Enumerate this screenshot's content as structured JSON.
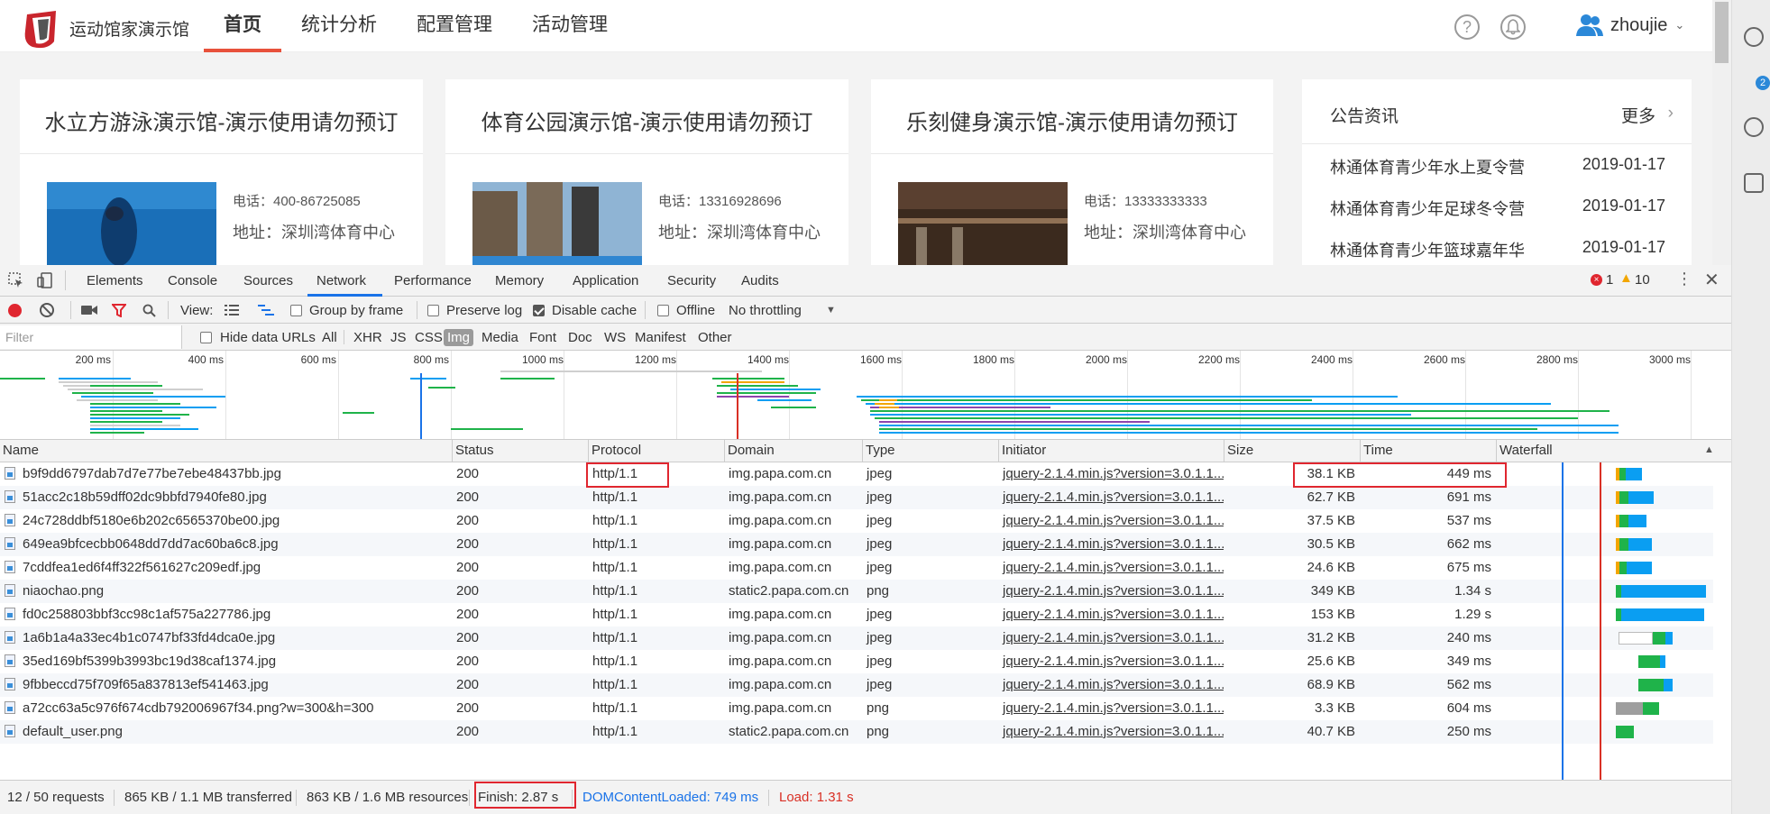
{
  "site": {
    "brand": "运动馆家演示馆",
    "nav": [
      "首页",
      "统计分析",
      "配置管理",
      "活动管理"
    ],
    "user": "zhoujie",
    "cards": [
      {
        "title": "水立方游泳演示馆-演示使用请勿预订",
        "phone": "电话：400-86725085",
        "address": "地址：深圳湾体育中心"
      },
      {
        "title": "体育公园演示馆-演示使用请勿预订",
        "phone": "电话：13316928696",
        "address": "地址：深圳湾体育中心"
      },
      {
        "title": "乐刻健身演示馆-演示使用请勿预订",
        "phone": "电话：13333333333",
        "address": "地址：深圳湾体育中心"
      }
    ],
    "notice": {
      "title": "公告资讯",
      "more": "更多",
      "items": [
        {
          "text": "林通体育青少年水上夏令营",
          "date": "2019-01-17"
        },
        {
          "text": "林通体育青少年足球冬令营",
          "date": "2019-01-17"
        },
        {
          "text": "林通体育青少年篮球嘉年华",
          "date": "2019-01-17"
        }
      ]
    },
    "side_badge": "2"
  },
  "devtools": {
    "tabs": [
      "Elements",
      "Console",
      "Sources",
      "Network",
      "Performance",
      "Memory",
      "Application",
      "Security",
      "Audits"
    ],
    "active_tab": "Network",
    "errors": "1",
    "warnings": "10",
    "toolbar": {
      "view_label": "View:",
      "group_by_frame": "Group by frame",
      "preserve_log": "Preserve log",
      "disable_cache": "Disable cache",
      "offline": "Offline",
      "throttling": "No throttling"
    },
    "filter": {
      "placeholder": "Filter",
      "hide_data_urls": "Hide data URLs",
      "types": [
        "All",
        "XHR",
        "JS",
        "CSS",
        "Img",
        "Media",
        "Font",
        "Doc",
        "WS",
        "Manifest",
        "Other"
      ],
      "active_type": "Img"
    },
    "overview_ticks": [
      "200 ms",
      "400 ms",
      "600 ms",
      "800 ms",
      "1000 ms",
      "1200 ms",
      "1400 ms",
      "1600 ms",
      "1800 ms",
      "2000 ms",
      "2200 ms",
      "2400 ms",
      "2600 ms",
      "2800 ms",
      "3000 ms"
    ],
    "columns": [
      "Name",
      "Status",
      "Protocol",
      "Domain",
      "Type",
      "Initiator",
      "Size",
      "Time",
      "Waterfall"
    ],
    "rows": [
      {
        "name": "b9f9dd6797dab7d7e77be7ebe48437bb.jpg",
        "status": "200",
        "protocol": "http/1.1",
        "domain": "img.papa.com.cn",
        "type": "jpeg",
        "initiator": "jquery-2.1.4.min.js?version=3.0.1.1...",
        "size": "38.1 KB",
        "time": "449 ms"
      },
      {
        "name": "51acc2c18b59dff02dc9bbfd7940fe80.jpg",
        "status": "200",
        "protocol": "http/1.1",
        "domain": "img.papa.com.cn",
        "type": "jpeg",
        "initiator": "jquery-2.1.4.min.js?version=3.0.1.1...",
        "size": "62.7 KB",
        "time": "691 ms"
      },
      {
        "name": "24c728ddbf5180e6b202c6565370be00.jpg",
        "status": "200",
        "protocol": "http/1.1",
        "domain": "img.papa.com.cn",
        "type": "jpeg",
        "initiator": "jquery-2.1.4.min.js?version=3.0.1.1...",
        "size": "37.5 KB",
        "time": "537 ms"
      },
      {
        "name": "649ea9bfcecbb0648dd7dd7ac60ba6c8.jpg",
        "status": "200",
        "protocol": "http/1.1",
        "domain": "img.papa.com.cn",
        "type": "jpeg",
        "initiator": "jquery-2.1.4.min.js?version=3.0.1.1...",
        "size": "30.5 KB",
        "time": "662 ms"
      },
      {
        "name": "7cddfea1ed6f4ff322f561627c209edf.jpg",
        "status": "200",
        "protocol": "http/1.1",
        "domain": "img.papa.com.cn",
        "type": "jpeg",
        "initiator": "jquery-2.1.4.min.js?version=3.0.1.1...",
        "size": "24.6 KB",
        "time": "675 ms"
      },
      {
        "name": "niaochao.png",
        "status": "200",
        "protocol": "http/1.1",
        "domain": "static2.papa.com.cn",
        "type": "png",
        "initiator": "jquery-2.1.4.min.js?version=3.0.1.1...",
        "size": "349 KB",
        "time": "1.34 s"
      },
      {
        "name": "fd0c258803bbf3cc98c1af575a227786.jpg",
        "status": "200",
        "protocol": "http/1.1",
        "domain": "img.papa.com.cn",
        "type": "jpeg",
        "initiator": "jquery-2.1.4.min.js?version=3.0.1.1...",
        "size": "153 KB",
        "time": "1.29 s"
      },
      {
        "name": "1a6b1a4a33ec4b1c0747bf33fd4dca0e.jpg",
        "status": "200",
        "protocol": "http/1.1",
        "domain": "img.papa.com.cn",
        "type": "jpeg",
        "initiator": "jquery-2.1.4.min.js?version=3.0.1.1...",
        "size": "31.2 KB",
        "time": "240 ms"
      },
      {
        "name": "35ed169bf5399b3993bc19d38caf1374.jpg",
        "status": "200",
        "protocol": "http/1.1",
        "domain": "img.papa.com.cn",
        "type": "jpeg",
        "initiator": "jquery-2.1.4.min.js?version=3.0.1.1...",
        "size": "25.6 KB",
        "time": "349 ms"
      },
      {
        "name": "9fbbeccd75f709f65a837813ef541463.jpg",
        "status": "200",
        "protocol": "http/1.1",
        "domain": "img.papa.com.cn",
        "type": "jpeg",
        "initiator": "jquery-2.1.4.min.js?version=3.0.1.1...",
        "size": "68.9 KB",
        "time": "562 ms"
      },
      {
        "name": "a72cc63a5c976f674cdb792006967f34.png?w=300&h=300",
        "status": "200",
        "protocol": "http/1.1",
        "domain": "img.papa.com.cn",
        "type": "png",
        "initiator": "jquery-2.1.4.min.js?version=3.0.1.1...",
        "size": "3.3 KB",
        "time": "604 ms"
      },
      {
        "name": "default_user.png",
        "status": "200",
        "protocol": "http/1.1",
        "domain": "static2.papa.com.cn",
        "type": "png",
        "initiator": "jquery-2.1.4.min.js?version=3.0.1.1...",
        "size": "40.7 KB",
        "time": "250 ms"
      }
    ],
    "status": {
      "requests": "12 / 50 requests",
      "transferred": "865 KB / 1.1 MB transferred",
      "resources": "863 KB / 1.6 MB resources",
      "finish": "Finish: 2.87 s",
      "dom_content_loaded": "DOMContentLoaded: 749 ms",
      "load": "Load: 1.31 s"
    },
    "colors": {
      "accent": "#1a73e8",
      "highlight_box": "#e0262f",
      "dcl_line": "#1a73e8",
      "load_line": "#d93025"
    }
  }
}
